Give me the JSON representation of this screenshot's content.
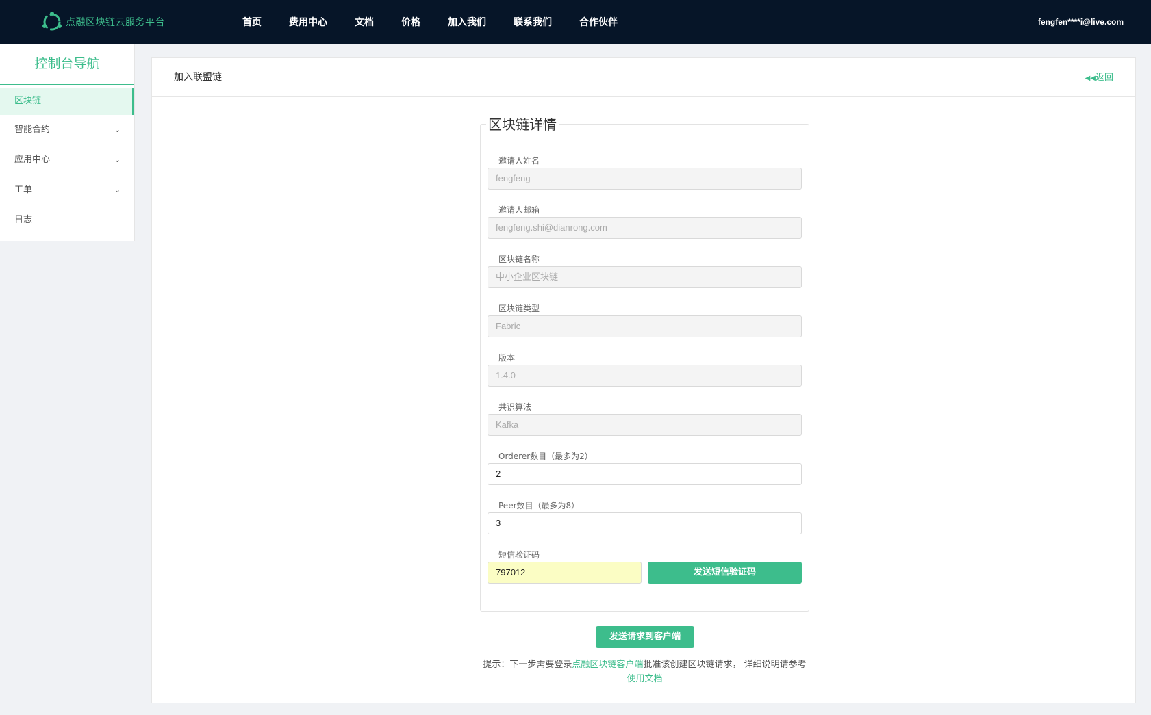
{
  "topbar": {
    "brand_name": "点融区块链云服务平台",
    "nav": [
      "首页",
      "费用中心",
      "文档",
      "价格",
      "加入我们",
      "联系我们",
      "合作伙伴"
    ],
    "user_email": "fengfen****i@live.com"
  },
  "sidebar": {
    "title": "控制台导航",
    "items": [
      {
        "label": "区块链",
        "active": true
      },
      {
        "label": "智能合约",
        "expandable": true
      },
      {
        "label": "应用中心",
        "expandable": true
      },
      {
        "label": "工单",
        "expandable": true
      },
      {
        "label": "日志"
      }
    ]
  },
  "panel": {
    "title": "加入联盟链",
    "back_label": "返回"
  },
  "form": {
    "legend": "区块链详情",
    "fields": [
      {
        "label": "邀请人姓名",
        "value": "fengfeng"
      },
      {
        "label": "邀请人邮箱",
        "value": "fengfeng.shi@dianrong.com"
      },
      {
        "label": "区块链名称",
        "value": "中小企业区块链"
      },
      {
        "label": "区块链类型",
        "value": "Fabric"
      },
      {
        "label": "版本",
        "value": "1.4.0"
      },
      {
        "label": "共识算法",
        "value": "Kafka"
      },
      {
        "label": "Orderer数目（最多为2）",
        "value": "2"
      },
      {
        "label": "Peer数目（最多为8）",
        "value": "3"
      }
    ],
    "sms": {
      "label": "短信验证码",
      "value": "797012",
      "button_label": "发送短信验证码"
    },
    "submit_label": "发送请求到客户端"
  },
  "hint": {
    "prefix": "提示：下一步需要登录",
    "client_link": "点融区块链客户端",
    "middle": "批准该创建区块链请求，  详细说明请参考",
    "docs_link": "使用文档"
  },
  "colors": {
    "accent": "#3dbd8c",
    "topbar": "#061528"
  }
}
